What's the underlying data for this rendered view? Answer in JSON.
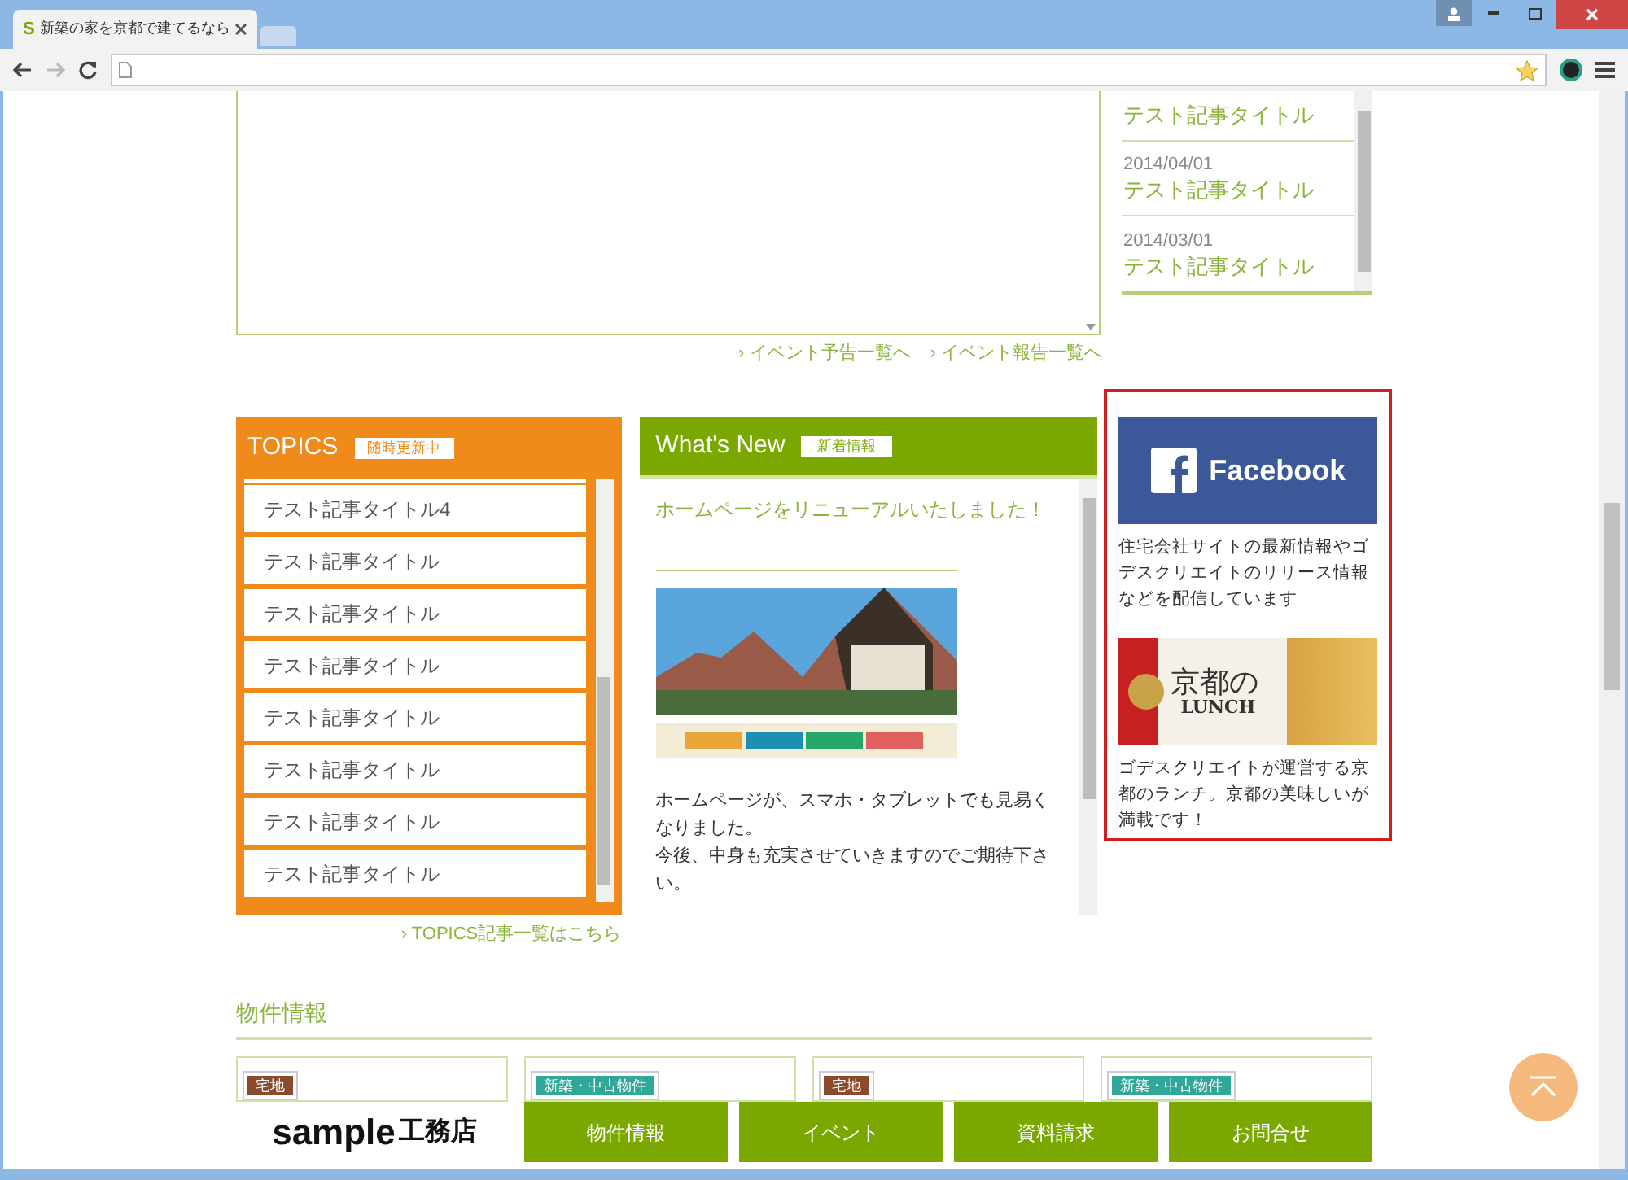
{
  "browser": {
    "favicon": "S",
    "tab_title": "新築の家を京都で建てるなら"
  },
  "events": {
    "articles": [
      {
        "title": "テスト記事タイトル"
      },
      {
        "date": "2014/04/01",
        "title": "テスト記事タイトル"
      },
      {
        "date": "2014/03/01",
        "title": "テスト記事タイトル"
      }
    ],
    "links": [
      "› イベント予告一覧へ",
      "› イベント報告一覧へ"
    ]
  },
  "topics": {
    "title": "TOPICS",
    "badge": "随時更新中",
    "items": [
      "テスト記事タイトル4",
      "テスト記事タイトル",
      "テスト記事タイトル",
      "テスト記事タイトル",
      "テスト記事タイトル",
      "テスト記事タイトル",
      "テスト記事タイトル",
      "テスト記事タイトル"
    ],
    "more_link": "› TOPICS記事一覧はこちら"
  },
  "whats_new": {
    "title": "What's New",
    "badge": "新着情報",
    "post_title": "ホームページをリニューアルいたしました！",
    "body": [
      "ホームページが、スマホ・タブレットでも見易くなりました。",
      "今後、中身も充実させていきますのでご期待下さい。"
    ]
  },
  "banners": [
    {
      "kind": "facebook",
      "label": "Facebook",
      "caption": "住宅会社サイトの最新情報やゴデスクリエイトのリリース情報などを配信しています"
    },
    {
      "kind": "lunch",
      "label": "京都の",
      "sublabel": "LUNCH",
      "caption": "ゴデスクリエイトが運営する京都のランチ。京都の美味しいが満載です！"
    }
  ],
  "properties": {
    "heading": "物件情報",
    "cards": [
      {
        "tag": "宅地",
        "color": "#8b4a2b"
      },
      {
        "tag": "新築・中古物件",
        "color": "#2fa89a"
      },
      {
        "tag": "宅地",
        "color": "#8b4a2b"
      },
      {
        "tag": "新築・中古物件",
        "color": "#2fa89a"
      }
    ]
  },
  "footer": {
    "logo": "sample",
    "logo_suffix": "工務店",
    "nav": [
      "物件情報",
      "イベント",
      "資料請求",
      "お問合せ"
    ]
  }
}
